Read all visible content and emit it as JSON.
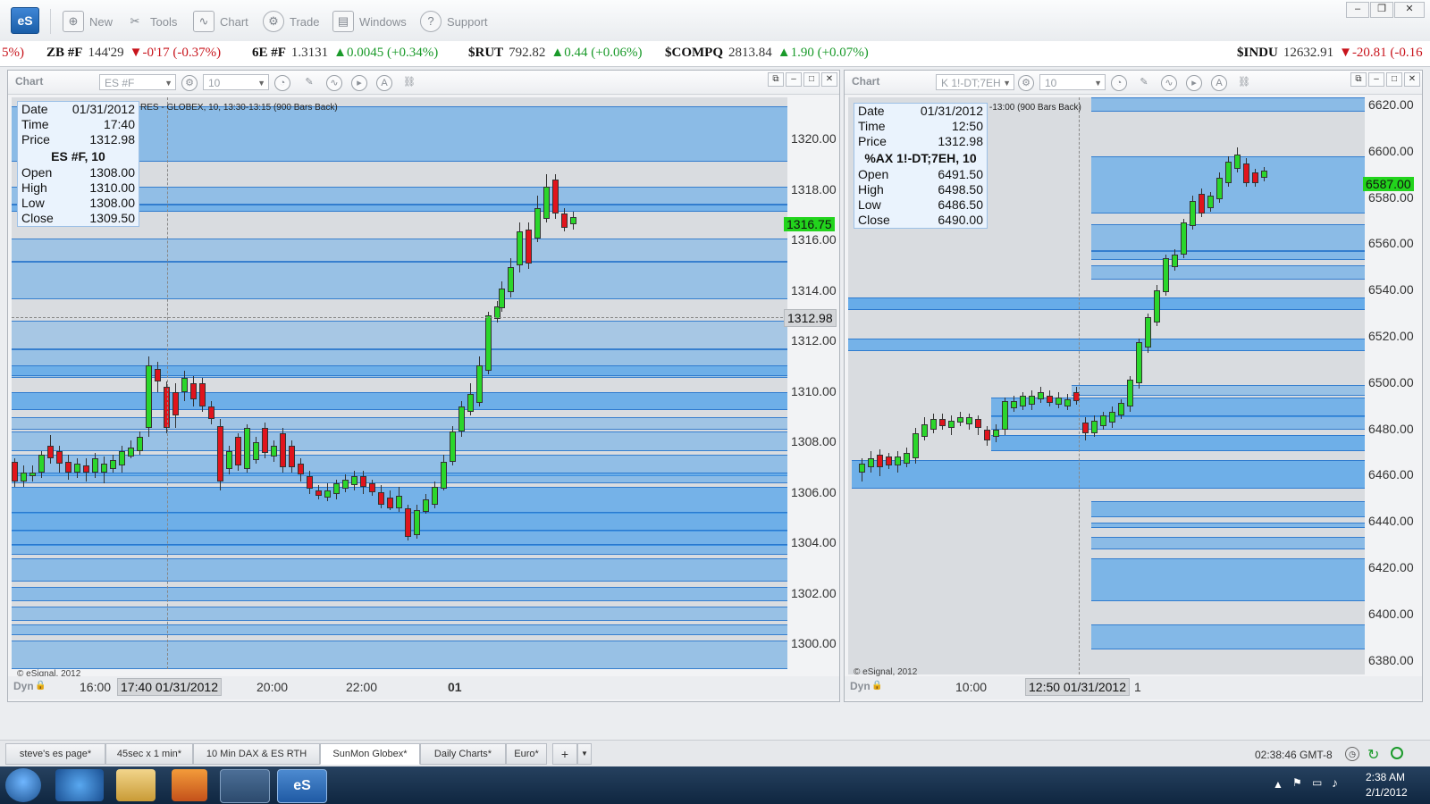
{
  "app": {
    "logo": "eS"
  },
  "toolbar": {
    "items": [
      {
        "label": "New",
        "icon": "new-chart-icon"
      },
      {
        "label": "Tools",
        "icon": "tools-icon"
      },
      {
        "label": "Chart",
        "icon": "chart-icon"
      },
      {
        "label": "Trade",
        "icon": "trade-icon"
      },
      {
        "label": "Windows",
        "icon": "windows-icon"
      },
      {
        "label": "Support",
        "icon": "support-icon"
      }
    ]
  },
  "ticker": [
    {
      "text": "5%)",
      "dir": "dn"
    },
    {
      "sym": "ZB #F",
      "price": "144'29",
      "change": "▼-0'17 (-0.37%)",
      "dir": "dn"
    },
    {
      "sym": "6E #F",
      "price": "1.3131",
      "change": "▲0.0045 (+0.34%)",
      "dir": "up"
    },
    {
      "sym": "$RUT",
      "price": "792.82",
      "change": "▲0.44 (+0.06%)",
      "dir": "up"
    },
    {
      "sym": "$COMPQ",
      "price": "2813.84",
      "change": "▲1.90 (+0.07%)",
      "dir": "up"
    },
    {
      "sym": "$INDU",
      "price": "12632.91",
      "change": "▼-20.81 (-0.16",
      "dir": "dn"
    }
  ],
  "chart_left": {
    "title": "Chart",
    "symbol": "ES #F",
    "interval": "10",
    "header_text": "RES - GLOBEX, 10, 13:30-13:15 (900 Bars Back)",
    "info": {
      "date_label": "Date",
      "date": "01/31/2012",
      "time_label": "Time",
      "time": "17:40",
      "price_label": "Price",
      "price": "1312.98",
      "heading": "ES #F, 10",
      "open_label": "Open",
      "open": "1308.00",
      "high_label": "High",
      "high": "1310.00",
      "low_label": "Low",
      "low": "1308.00",
      "close_label": "Close",
      "close": "1309.50"
    },
    "y_ticks": [
      "1320.00",
      "1318.00",
      "1316.00",
      "1314.00",
      "1312.00",
      "1310.00",
      "1308.00",
      "1306.00",
      "1304.00",
      "1302.00",
      "1300.00"
    ],
    "last_price": "1316.75",
    "cursor_price": "1312.98",
    "x_labels": [
      "16:00",
      "20:00",
      "22:00",
      "01"
    ],
    "cursor_time": "17:40 01/31/2012",
    "dyn": "Dyn",
    "copyright": "© eSignal, 2012"
  },
  "chart_right": {
    "title": "Chart",
    "symbol": "K 1!-DT;7EH",
    "interval": "10",
    "header_text": "-13:00 (900 Bars Back)",
    "info": {
      "date_label": "Date",
      "date": "01/31/2012",
      "time_label": "Time",
      "time": "12:50",
      "price_label": "Price",
      "price": "1312.98",
      "heading": "%AX 1!-DT;7EH, 10",
      "open_label": "Open",
      "open": "6491.50",
      "high_label": "High",
      "high": "6498.50",
      "low_label": "Low",
      "low": "6486.50",
      "close_label": "Close",
      "close": "6490.00"
    },
    "y_ticks": [
      "6620.00",
      "6600.00",
      "6580.00",
      "6560.00",
      "6540.00",
      "6520.00",
      "6500.00",
      "6480.00",
      "6460.00",
      "6440.00",
      "6420.00",
      "6400.00",
      "6380.00"
    ],
    "last_price": "6587.00",
    "x_labels": [
      "10:00",
      "1"
    ],
    "cursor_time": "12:50 01/31/2012",
    "dyn": "Dyn",
    "copyright": "© eSignal, 2012"
  },
  "tabs": [
    {
      "label": "steve's es page*"
    },
    {
      "label": "45sec x 1 min*"
    },
    {
      "label": "10 Min DAX & ES RTH"
    },
    {
      "label": "SunMon Globex*",
      "active": true
    },
    {
      "label": "Daily Charts*"
    },
    {
      "label": "Euro*"
    },
    {
      "label": "+"
    }
  ],
  "status": {
    "clock": "02:38:46 GMT-8"
  },
  "taskbar": {
    "time": "2:38 AM",
    "date": "2/1/2012"
  }
}
